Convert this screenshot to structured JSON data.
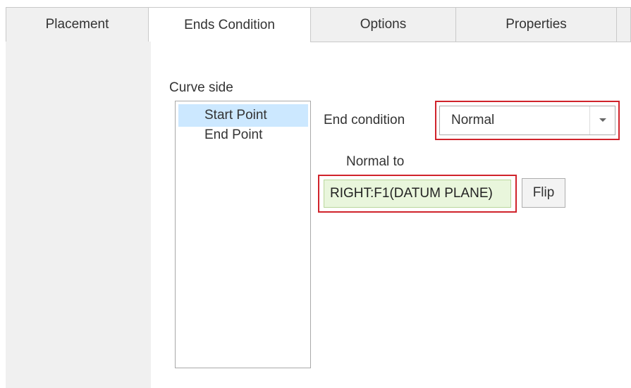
{
  "tabs": [
    {
      "label": "Placement",
      "active": false
    },
    {
      "label": "Ends Condition",
      "active": true
    },
    {
      "label": "Options",
      "active": false
    },
    {
      "label": "Properties",
      "active": false
    }
  ],
  "curve_side": {
    "label": "Curve side",
    "items": [
      {
        "label": "Start Point",
        "selected": true
      },
      {
        "label": "End Point",
        "selected": false
      }
    ]
  },
  "end_condition": {
    "label": "End condition",
    "value": "Normal",
    "icon": "dropdown-arrow-icon"
  },
  "normal_to": {
    "label": "Normal to",
    "reference": "RIGHT:F1(DATUM PLANE)",
    "flip_label": "Flip"
  },
  "colors": {
    "highlight": "#d0232b",
    "selection": "#cce8ff",
    "reference_bg": "#e9f6dc"
  }
}
